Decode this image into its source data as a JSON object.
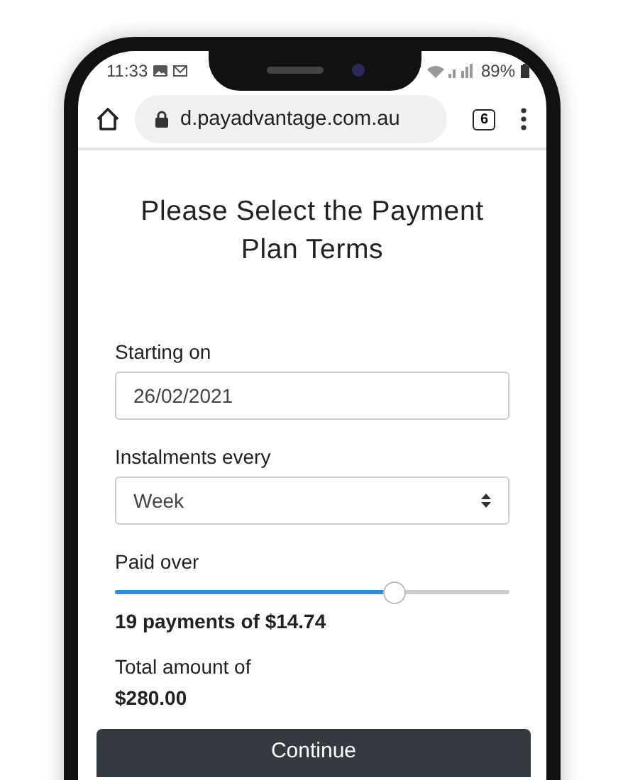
{
  "status_bar": {
    "time": "11:33",
    "battery": "89%"
  },
  "browser": {
    "url": "d.payadvantage.com.au",
    "tab_count": "6"
  },
  "title": "Please Select the Payment Plan Terms",
  "start_field": {
    "label": "Starting on",
    "value": "26/02/2021"
  },
  "instalments_field": {
    "label": "Instalments every",
    "value": "Week"
  },
  "paid_over": {
    "label": "Paid over",
    "level": 0.71,
    "summary": "19 payments of $14.74"
  },
  "total": {
    "label": "Total amount of",
    "value": "$280.00"
  },
  "buttons": [
    "Continue"
  ]
}
